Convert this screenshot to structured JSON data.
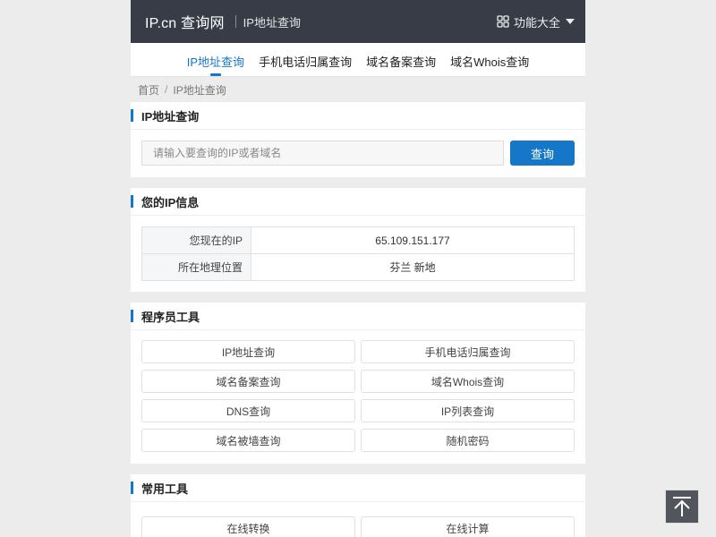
{
  "header": {
    "logo": "IP.cn 查询网",
    "subtitle": "IP地址查询",
    "menu_label": "功能大全"
  },
  "nav": {
    "tabs": [
      {
        "label": "IP地址查询",
        "active": true
      },
      {
        "label": "手机电话归属查询",
        "active": false
      },
      {
        "label": "域名备案查询",
        "active": false
      },
      {
        "label": "域名Whois查询",
        "active": false
      }
    ]
  },
  "breadcrumb": {
    "home": "首页",
    "separator": "/",
    "current": "IP地址查询"
  },
  "search": {
    "title": "IP地址查询",
    "placeholder": "请输入要查询的IP或者域名",
    "button_label": "查询"
  },
  "ip_info": {
    "title": "您的IP信息",
    "rows": [
      {
        "key": "您现在的IP",
        "value": "65.109.151.177"
      },
      {
        "key": "所在地理位置",
        "value": "芬兰 新地"
      }
    ]
  },
  "dev_tools": {
    "title": "程序员工具",
    "items": [
      "IP地址查询",
      "手机电话归属查询",
      "域名备案查询",
      "域名Whois查询",
      "DNS查询",
      "IP列表查询",
      "域名被墙查询",
      "随机密码"
    ]
  },
  "common_tools": {
    "title": "常用工具",
    "items": [
      "在线转换",
      "在线计算"
    ]
  },
  "colors": {
    "accent": "#1677c8",
    "header_bg": "#383c47",
    "page_bg": "#ececec"
  }
}
